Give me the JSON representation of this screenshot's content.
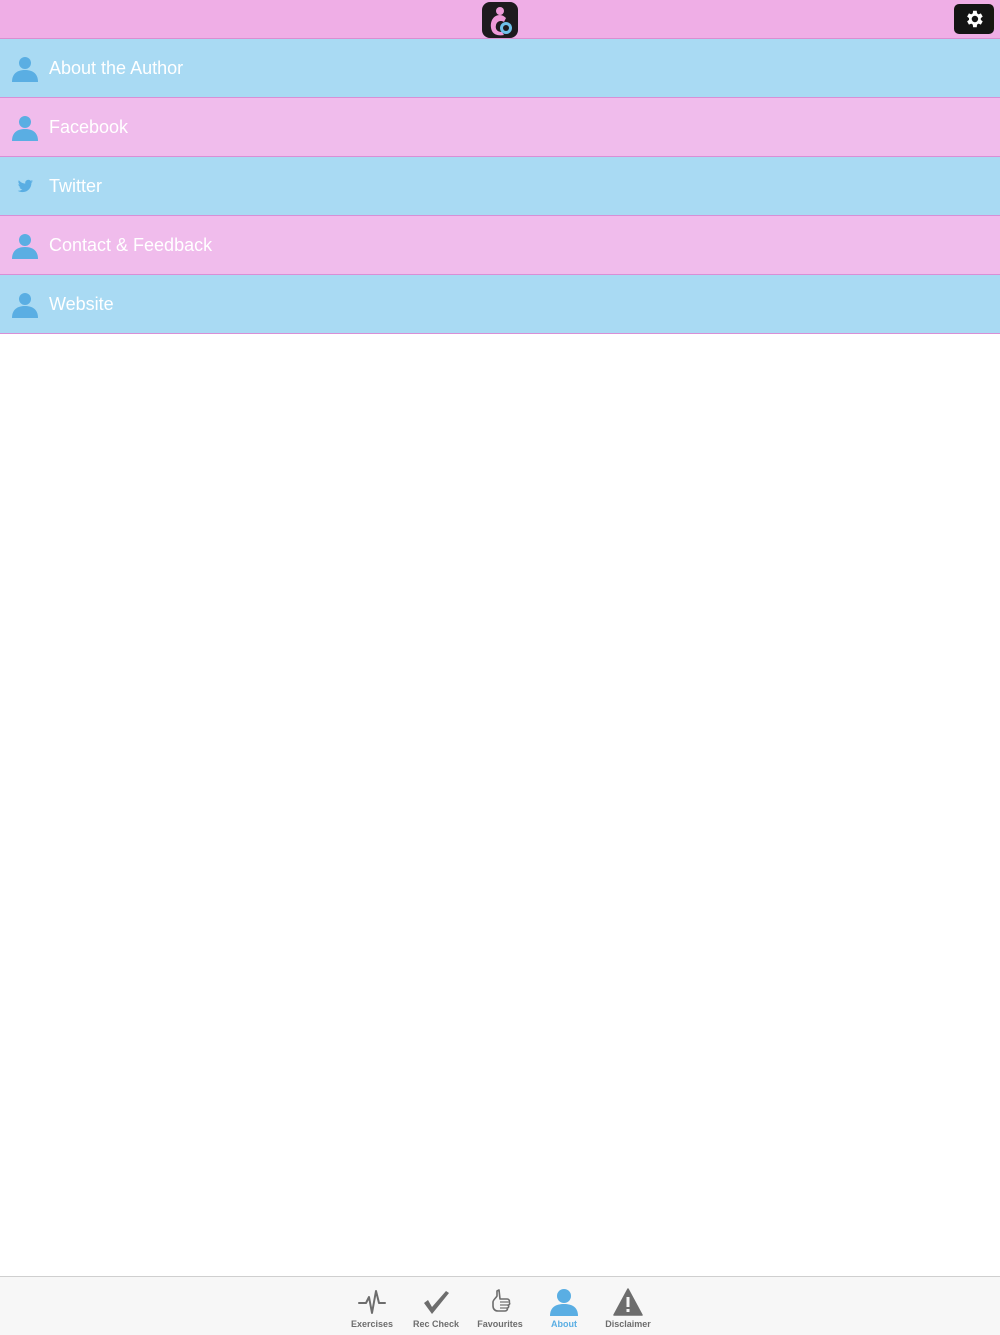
{
  "header": {
    "logo_icon": "app-logo-icon",
    "settings_icon": "gear-icon"
  },
  "menu": {
    "items": [
      {
        "label": "About the Author",
        "icon": "person-icon"
      },
      {
        "label": "Facebook",
        "icon": "person-icon"
      },
      {
        "label": "Twitter",
        "icon": "twitter-bird-icon"
      },
      {
        "label": "Contact & Feedback",
        "icon": "person-icon"
      },
      {
        "label": "Website",
        "icon": "person-icon"
      }
    ]
  },
  "tabbar": {
    "tabs": [
      {
        "label": "Exercises",
        "icon": "pulse-icon"
      },
      {
        "label": "Rec Check",
        "icon": "checkmark-icon"
      },
      {
        "label": "Favourites",
        "icon": "thumbs-up-icon"
      },
      {
        "label": "About",
        "icon": "person-icon"
      },
      {
        "label": "Disclaimer",
        "icon": "warning-icon"
      }
    ],
    "active_tab": "About"
  },
  "colors": {
    "header_bg": "#efaee6",
    "row_blue": "#a9daf3",
    "row_pink": "#f0bcec",
    "icon_blue": "#5aaee3",
    "tab_inactive": "#6d6d6d"
  }
}
